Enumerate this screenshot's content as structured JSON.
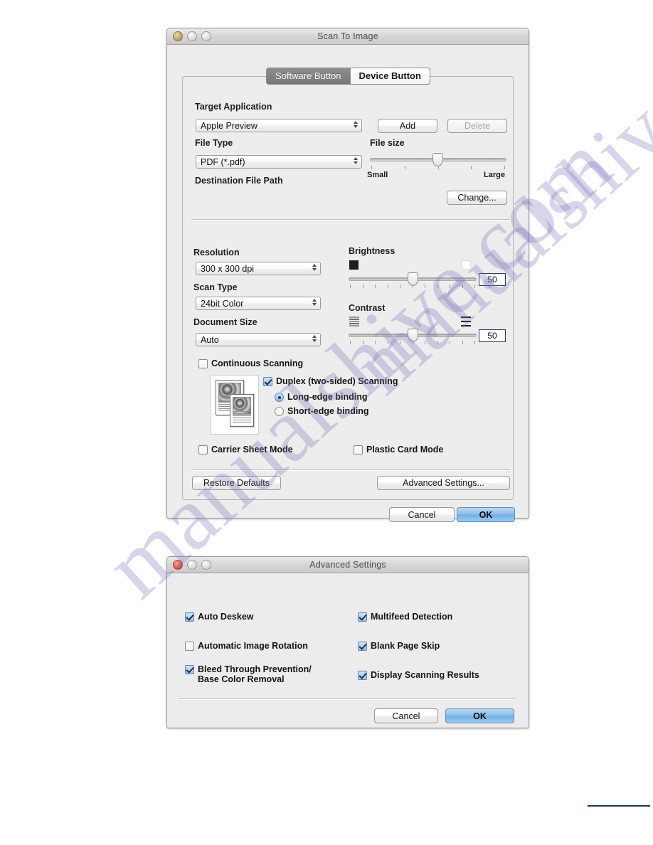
{
  "page": {
    "watermark_text": "manualshive.com",
    "background": "#ffffff"
  },
  "scan_dialog": {
    "title": "Scan To Image",
    "traffic_lights": [
      "close-amber",
      "minimize-inactive",
      "zoom-inactive"
    ],
    "tabs": [
      {
        "label": "Software Button",
        "selected": true
      },
      {
        "label": "Device Button",
        "selected": false
      }
    ],
    "target_application": {
      "label": "Target Application",
      "selected": "Apple Preview",
      "options": [
        "Apple Preview"
      ],
      "add_label": "Add",
      "delete_label": "Delete",
      "delete_disabled": true
    },
    "file_type": {
      "label": "File Type",
      "selected": "PDF (*.pdf)",
      "options": [
        "PDF (*.pdf)"
      ]
    },
    "file_size": {
      "label": "File size",
      "min_label": "Small",
      "max_label": "Large",
      "value": 50,
      "ticks": 5
    },
    "destination_file_path": {
      "label": "Destination File Path",
      "change_label": "Change..."
    },
    "resolution": {
      "label": "Resolution",
      "selected": "300 x 300 dpi",
      "options": [
        "300 x 300 dpi"
      ]
    },
    "scan_type": {
      "label": "Scan Type",
      "selected": "24bit Color",
      "options": [
        "24bit Color"
      ]
    },
    "document_size": {
      "label": "Document Size",
      "selected": "Auto",
      "options": [
        "Auto"
      ]
    },
    "brightness": {
      "label": "Brightness",
      "value": "50",
      "ticks": 11,
      "left_icon": "black-swatch-icon",
      "right_icon": "white-swatch-icon"
    },
    "contrast": {
      "label": "Contrast",
      "value": "50",
      "ticks": 11,
      "left_icon": "low-contrast-stripes-icon",
      "right_icon": "high-contrast-stripes-icon"
    },
    "continuous_scanning": {
      "label": "Continuous Scanning",
      "checked": false
    },
    "duplex": {
      "label": "Duplex (two-sided) Scanning",
      "checked": true,
      "binding_options": [
        {
          "label": "Long-edge binding",
          "selected": true
        },
        {
          "label": "Short-edge binding",
          "selected": false
        }
      ]
    },
    "carrier_sheet_mode": {
      "label": "Carrier Sheet Mode",
      "checked": false
    },
    "plastic_card_mode": {
      "label": "Plastic Card Mode",
      "checked": false
    },
    "restore_defaults_label": "Restore Defaults",
    "advanced_settings_label": "Advanced Settings...",
    "cancel_label": "Cancel",
    "ok_label": "OK"
  },
  "advanced_dialog": {
    "title": "Advanced Settings",
    "traffic_lights": [
      "close-active",
      "minimize-inactive",
      "zoom-inactive"
    ],
    "options_left": [
      {
        "label": "Auto Deskew",
        "checked": true
      },
      {
        "label": "Automatic Image Rotation",
        "checked": false
      },
      {
        "label": "Bleed Through Prevention/\nBase Color Removal",
        "checked": true
      }
    ],
    "options_right": [
      {
        "label": "Multifeed Detection",
        "checked": true
      },
      {
        "label": "Blank Page Skip",
        "checked": true
      },
      {
        "label": "Display Scanning Results",
        "checked": true
      }
    ],
    "cancel_label": "Cancel",
    "ok_label": "OK"
  }
}
